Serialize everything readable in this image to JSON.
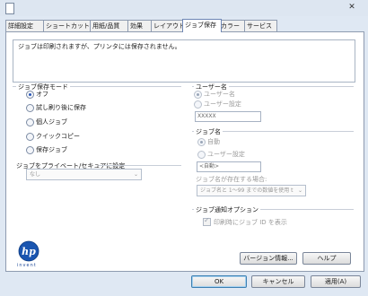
{
  "tabs": [
    "詳細設定",
    "ショートカット",
    "用紙/品質",
    "効果",
    "レイアウト",
    "ジョブ保存",
    "カラー",
    "サービス"
  ],
  "message": "ジョブは印刷されますが、プリンタには保存されません。",
  "job_storage_mode": {
    "title": "ジョブ保存モード",
    "options": [
      "オフ",
      "試し刷り後に保存",
      "個人ジョブ",
      "クイックコピー",
      "保存ジョブ"
    ],
    "selected": "オフ"
  },
  "private_secure": {
    "title": "ジョブをプライベート/セキュアに設定",
    "value": "なし"
  },
  "user_name": {
    "title": "ユーザー名",
    "options": [
      "ユーザー名",
      "ユーザー設定"
    ],
    "input": "XXXXX"
  },
  "job_name": {
    "title": "ジョブ名",
    "auto": "自動",
    "custom": "ユーザー設定",
    "input": "<自動>",
    "exists_label": "ジョブ名が存在する場合:",
    "exists_value": "ジョブ名と 1～99 までの数値を使用 t"
  },
  "notify": {
    "title": "ジョブ通知オプション",
    "checkbox": "印刷時にジョブ ID を表示"
  },
  "brand": "invent",
  "buttons": {
    "version": "バージョン情報...",
    "help": "ヘルプ",
    "ok": "OK",
    "cancel": "キャンセル",
    "apply": "適用(A)"
  },
  "icons": {
    "close": "close-icon",
    "doc": "document-icon",
    "logo": "hp-logo-icon"
  }
}
